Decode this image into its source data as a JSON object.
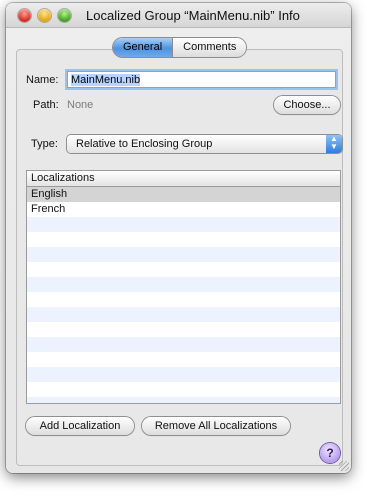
{
  "window": {
    "title": "Localized Group “MainMenu.nib” Info"
  },
  "tabs": [
    {
      "label": "General",
      "active": true
    },
    {
      "label": "Comments",
      "active": false
    }
  ],
  "form": {
    "name_label": "Name:",
    "name_value": "MainMenu.nib",
    "path_label": "Path:",
    "path_value": "None",
    "choose_button": "Choose...",
    "type_label": "Type:",
    "type_value": "Relative to Enclosing Group"
  },
  "localizations": {
    "header": "Localizations",
    "items": [
      "English",
      "French"
    ]
  },
  "buttons": {
    "add": "Add Localization",
    "remove_all": "Remove All Localizations"
  },
  "help": {
    "label": "?"
  },
  "colors": {
    "accent": "#4f93e0",
    "row_alt": "#edf3fe",
    "row_selected": "#d4d4d4"
  }
}
